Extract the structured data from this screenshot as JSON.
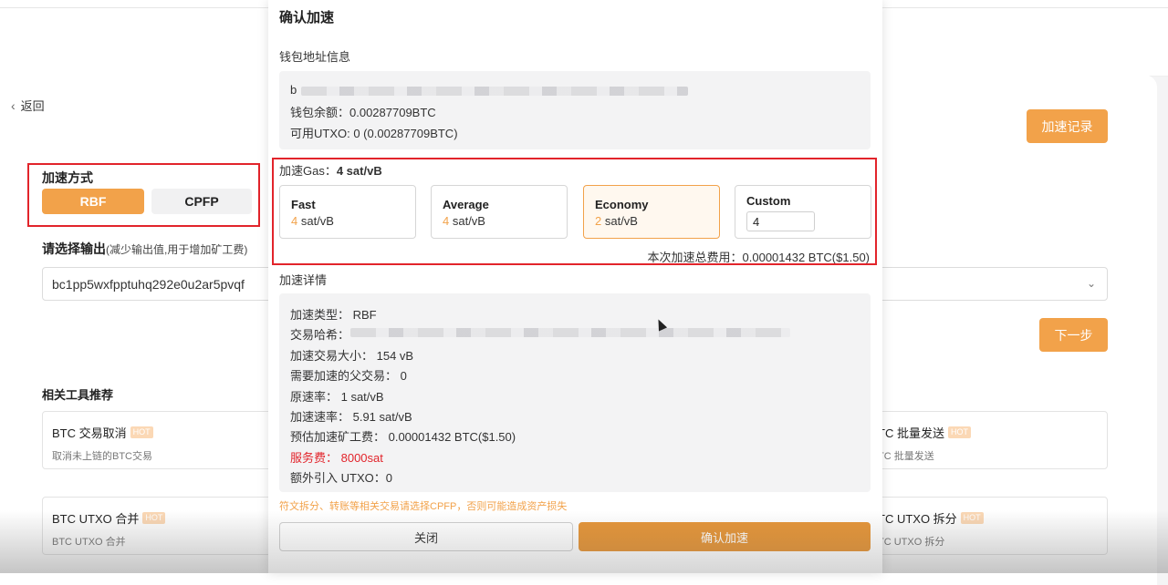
{
  "page": {
    "back_label": "返回",
    "accel_method_label": "加速方式",
    "method_rbf": "RBF",
    "method_cpfp": "CPFP",
    "choose_output_label": "请选择输出",
    "choose_output_hint": "(减少输出值,用于增加矿工费)",
    "output_value": "bc1pp5wxfpptuhq292e0u2ar5pvqf",
    "accel_record_button": "加速记录",
    "next_button": "下一步",
    "tools_title": "相关工具推荐",
    "hot_badge": "HOT",
    "tools": [
      {
        "title": "BTC 交易取消",
        "sub": "取消未上链的BTC交易"
      },
      {
        "title": "BTC UTXO 合并",
        "sub": "BTC UTXO 合并"
      },
      {
        "title": "TC 批量发送",
        "sub": "TC 批量发送"
      },
      {
        "title": "TC UTXO 拆分",
        "sub": "TC UTXO 拆分"
      }
    ],
    "colors": {
      "accent": "#f2a24a",
      "annotation_red": "#e2242b"
    }
  },
  "modal": {
    "title": "确认加速",
    "wallet_info_label": "钱包地址信息",
    "wallet_address_prefix": "b",
    "wallet_balance": "钱包余额：0.00287709BTC",
    "available_utxo": "可用UTXO: 0 (0.00287709BTC)",
    "gas_label": "加速Gas：",
    "gas_value": "4 sat/vB",
    "speeds": [
      {
        "name": "Fast",
        "num": "4",
        "unit": " sat/vB"
      },
      {
        "name": "Average",
        "num": "4",
        "unit": " sat/vB"
      },
      {
        "name": "Economy",
        "num": "2",
        "unit": " sat/vB"
      }
    ],
    "custom_label": "Custom",
    "custom_value": "4",
    "total_fee": "本次加速总费用：0.00001432 BTC($1.50)",
    "details_label": "加速详情",
    "details": {
      "type": "加速类型：  RBF",
      "hash_label": "交易哈希：",
      "size": "加速交易大小：  154 vB",
      "parent": "需要加速的父交易：  0",
      "orig_rate": "原速率：  1 sat/vB",
      "new_rate": "加速速率：  5.91 sat/vB",
      "est_fee": "预估加速矿工费：  0.00001432 BTC($1.50)",
      "service_fee": "服务费：  8000sat",
      "extra_utxo": "额外引入 UTXO：0"
    },
    "warning": "符文拆分、转账等相关交易请选择CPFP，否则可能造成资产损失",
    "close_button": "关闭",
    "confirm_button": "确认加速"
  }
}
